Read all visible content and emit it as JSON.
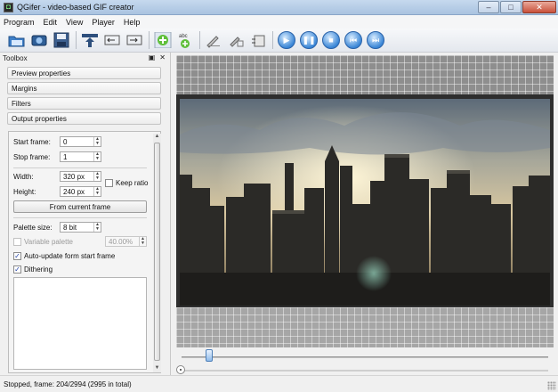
{
  "window": {
    "title": "QGifer - video-based GIF creator",
    "minimize_glyph": "–",
    "maximize_glyph": "□",
    "close_glyph": "✕"
  },
  "menu": [
    {
      "label": "Program"
    },
    {
      "label": "Edit"
    },
    {
      "label": "View"
    },
    {
      "label": "Player"
    },
    {
      "label": "Help"
    }
  ],
  "toolbar": {
    "buttons": [
      {
        "icon": "open-folder-icon"
      },
      {
        "icon": "open-video-icon"
      },
      {
        "icon": "save-icon"
      },
      {
        "icon": "extract-gif-icon"
      },
      {
        "icon": "set-start-icon"
      },
      {
        "icon": "set-end-icon"
      },
      {
        "icon": "add-object-icon"
      },
      {
        "icon": "add-text-icon"
      },
      {
        "icon": "draw-icon"
      },
      {
        "icon": "edit-tool-icon"
      },
      {
        "icon": "crop-icon"
      },
      {
        "icon": "play-icon"
      },
      {
        "icon": "pause-icon"
      },
      {
        "icon": "stop-icon"
      },
      {
        "icon": "prev-frame-icon"
      },
      {
        "icon": "next-frame-icon"
      }
    ],
    "text_icon_label": "abc"
  },
  "toolbox": {
    "title": "Toolbox",
    "sections": [
      {
        "label": "Preview properties"
      },
      {
        "label": "Margins"
      },
      {
        "label": "Filters"
      },
      {
        "label": "Output properties"
      }
    ],
    "output": {
      "start_frame_label": "Start frame:",
      "start_frame_value": "0",
      "stop_frame_label": "Stop frame:",
      "stop_frame_value": "1",
      "width_label": "Width:",
      "width_value": "320 px",
      "height_label": "Height:",
      "height_value": "240 px",
      "keep_ratio_label": "Keep ratio",
      "keep_ratio_checked": false,
      "from_current_frame_label": "From current frame",
      "palette_size_label": "Palette size:",
      "palette_size_value": "8 bit",
      "variable_palette_label": "Variable palette",
      "variable_palette_checked": false,
      "variable_palette_value": "40.00%",
      "auto_update_label": "Auto-update form start frame",
      "auto_update_checked": true,
      "dithering_label": "Dithering",
      "dithering_checked": true
    }
  },
  "player": {
    "position_fraction": 0.068
  },
  "status": {
    "text": "Stopped, frame: 204/2994 (2995 in total)"
  },
  "colors": {
    "accent_blue": "#3a86d6",
    "viewer_bg": "#2e2e2e"
  }
}
